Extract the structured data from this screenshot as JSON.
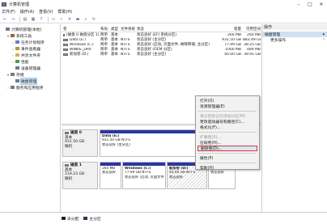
{
  "window": {
    "title": "计算机管理",
    "minimize_label": "–",
    "maximize_label": "□",
    "close_label": "✕"
  },
  "menu": [
    "文件(F)",
    "操作(A)",
    "查看(V)",
    "帮助(H)"
  ],
  "tree": [
    {
      "label": "计算机管理(本地)",
      "indent": 0,
      "expander": "",
      "icon_color": "#6d7d8c"
    },
    {
      "label": "系统工具",
      "indent": 1,
      "expander": "▾",
      "icon_color": "#8a6d3b"
    },
    {
      "label": "任务计划程序",
      "indent": 2,
      "expander": "›",
      "icon_color": "#5a87c5"
    },
    {
      "label": "事件查看器",
      "indent": 2,
      "expander": "›",
      "icon_color": "#c58b35"
    },
    {
      "label": "共享文件夹",
      "indent": 2,
      "expander": "›",
      "icon_color": "#d6b24a"
    },
    {
      "label": "性能",
      "indent": 2,
      "expander": "›",
      "icon_color": "#4e9c4e"
    },
    {
      "label": "设备管理器",
      "indent": 2,
      "expander": "",
      "icon_color": "#6d7d8c"
    },
    {
      "label": "存储",
      "indent": 1,
      "expander": "▾",
      "icon_color": "#6d7d8c"
    },
    {
      "label": "磁盘管理",
      "indent": 2,
      "expander": "",
      "icon_color": "#6d7d8c",
      "selected": true
    },
    {
      "label": "服务和应用程序",
      "indent": 1,
      "expander": "›",
      "icon_color": "#6d7d8c"
    }
  ],
  "volumes": {
    "headers": [
      "卷",
      "布局",
      "类型",
      "文件系统",
      "状态",
      "容量",
      "可用空间"
    ],
    "rows": [
      [
        "(磁盘 0 磁盘分区 1)",
        "简单",
        "基本",
        "",
        "状态良好 (EFI 系统分区)",
        "260 MB",
        "260 MB"
      ],
      [
        "Data (E:)",
        "简单",
        "基本",
        "NTFS",
        "状态良好 (主分区)",
        "931.50 GB",
        "883.49 GB"
      ],
      [
        "Windows (C:)",
        "简单",
        "基本",
        "NTFS",
        "状态良好 (启动, 页面文件, 故障转储, 主分区)",
        "77.99 GB",
        "38.25 GB"
      ],
      [
        "WINRE_DRV",
        "简单",
        "基本",
        "NTFS",
        "状态良好 (OEM 分区)",
        "1000 MB",
        "489 MB"
      ],
      [
        "新加卷 (D:)",
        "简单",
        "基本",
        "NTFS",
        "状态良好 (主分区)",
        "40.00 GB",
        "39.91 GB"
      ]
    ]
  },
  "disks": [
    {
      "name": "磁盘 0",
      "type": "基本",
      "size": "931.50 GB",
      "status": "联机",
      "partitions": [
        {
          "name": "Data (E:)",
          "size": "931.50 GB NTFS",
          "status": "状态良好 (主分区)"
        }
      ]
    },
    {
      "name": "磁盘 1",
      "type": "基本",
      "size": "119.23 GB",
      "status": "联机",
      "partitions": [
        {
          "name": "",
          "size": "260 MB",
          "status": "状态良好"
        },
        {
          "name": "Windows (C:)",
          "size": "77.99 GB NTFS",
          "status": "状态良好 (启动, 页面文件"
        },
        {
          "name": "新加卷 (D:)",
          "size": "40.00 GB NTFS",
          "status": "状态良好"
        },
        {
          "name": "",
          "size": "1000 MB",
          "status": "状态良好"
        }
      ]
    }
  ],
  "context_menu": {
    "items": [
      {
        "label": "打开(O)"
      },
      {
        "label": "资源管理器(E)"
      },
      {
        "sep": true
      },
      {
        "label": "将分区标记为活动分区(M)",
        "disabled": true
      },
      {
        "label": "更改驱动器号和路径(C)..."
      },
      {
        "label": "格式化(F)..."
      },
      {
        "sep": true
      },
      {
        "label": "扩展卷(X)...",
        "disabled": true
      },
      {
        "label": "压缩卷(H)..."
      },
      {
        "label": "删除卷(D)...",
        "highlight": true
      },
      {
        "sep": true
      },
      {
        "label": "属性(P)"
      },
      {
        "sep": true
      },
      {
        "label": "帮助(H)"
      }
    ]
  },
  "actions": {
    "title": "操作",
    "section": "磁盘管理",
    "section_arrow": "▴",
    "more": "更多操作",
    "more_arrow": "›"
  },
  "legend": [
    {
      "label": "未分配",
      "color": "#111111"
    },
    {
      "label": "主分区",
      "color": "#2c34a6"
    }
  ]
}
